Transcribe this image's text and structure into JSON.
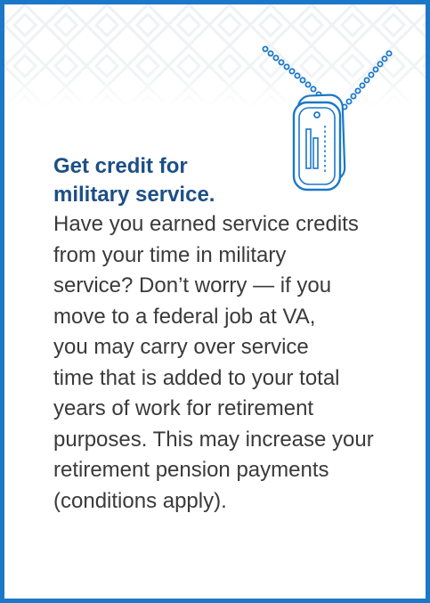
{
  "colors": {
    "border": "#1b78c8",
    "heading": "#1c4f86",
    "body": "#3a3a3a",
    "icon_stroke": "#1b78c8",
    "pattern": "#eef0f3"
  },
  "icon": "military-dog-tag-icon",
  "heading_lines": [
    "Get credit for",
    "military service."
  ],
  "body_lines": [
    "Have you earned service credits",
    "from your time in military",
    "service? Don’t worry — if you",
    "move to a federal job at VA,",
    "you may carry over service",
    "time that is added to your total",
    "years of work for retirement",
    "purposes. This may increase your",
    "retirement pension payments",
    "(conditions apply)."
  ]
}
